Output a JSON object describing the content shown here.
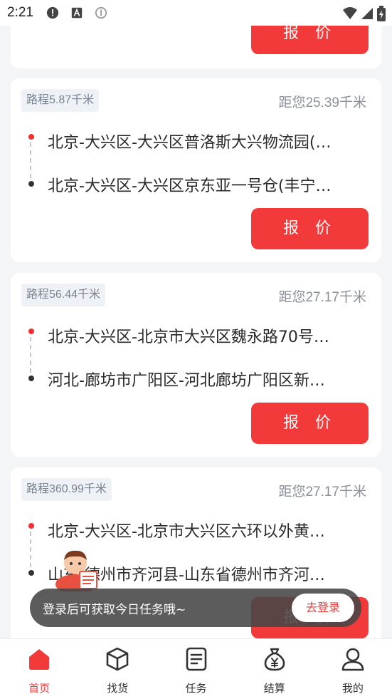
{
  "status_bar": {
    "time": "2:21"
  },
  "cards": [
    {
      "quote_label": "报 价"
    },
    {
      "route_tag": "路程5.87千米",
      "distance": "距您25.39千米",
      "from": "北京-大兴区-大兴区普洛斯大兴物流园(…",
      "to": "北京-大兴区-大兴区京东亚一号仓(丰宁…",
      "quote_label": "报 价"
    },
    {
      "route_tag": "路程56.44千米",
      "distance": "距您27.17千米",
      "from": "北京-大兴区-北京市大兴区魏永路70号…",
      "to": "河北-廊坊市广阳区-河北廊坊广阳区新…",
      "quote_label": "报 价"
    },
    {
      "route_tag": "路程360.99千米",
      "distance": "距您27.17千米",
      "from": "北京-大兴区-北京市大兴区六环以外黄…",
      "to": "山东-德州市齐河县-山东省德州市齐河…",
      "quote_label": "报 价"
    }
  ],
  "toast": {
    "message": "登录后可获取今日任务哦~",
    "login_label": "去登录"
  },
  "tabbar": {
    "items": [
      {
        "label": "首页",
        "icon": "home-icon",
        "active": true
      },
      {
        "label": "找货",
        "icon": "box-icon",
        "active": false
      },
      {
        "label": "任务",
        "icon": "task-document-icon",
        "active": false
      },
      {
        "label": "结算",
        "icon": "money-bag-icon",
        "active": false
      },
      {
        "label": "我的",
        "icon": "user-icon",
        "active": false
      }
    ]
  },
  "colors": {
    "accent": "#f23a3a",
    "background": "#f4f5f7",
    "tag_bg": "#eef1f6"
  }
}
